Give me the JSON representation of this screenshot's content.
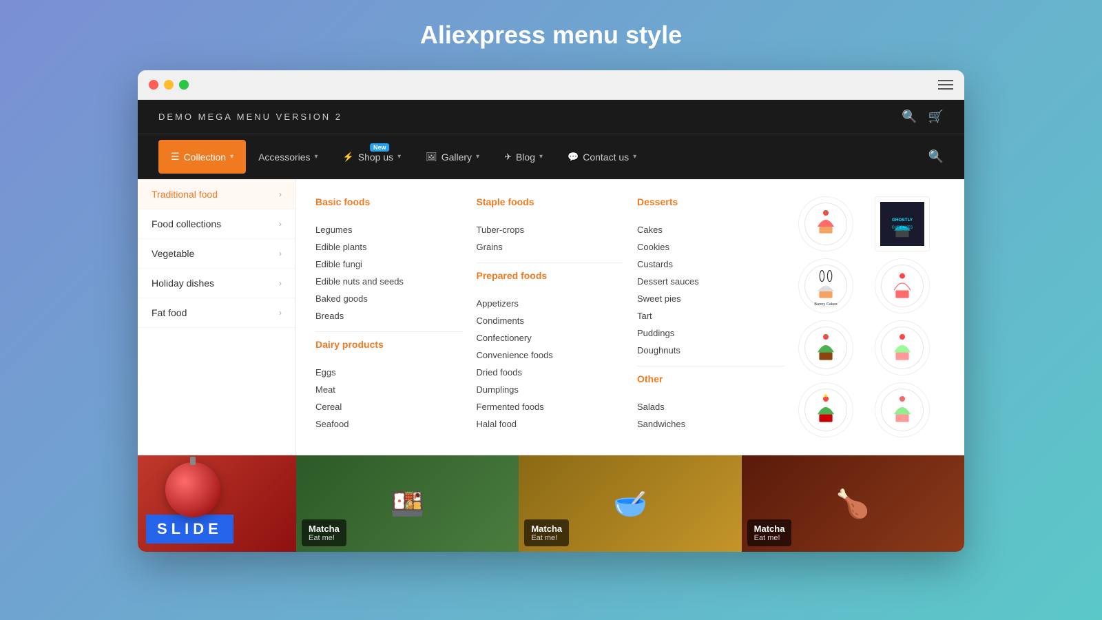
{
  "page": {
    "title": "Aliexpress menu style"
  },
  "browser": {
    "dots": [
      "red",
      "yellow",
      "green"
    ]
  },
  "navbar_top": {
    "site_title": "DEMO MEGA MENU VERSION 2"
  },
  "main_nav": {
    "items": [
      {
        "label": "Collection",
        "active": true,
        "icon": "menu-lines",
        "chevron": true
      },
      {
        "label": "Accessories",
        "active": false,
        "chevron": true
      },
      {
        "label": "Shop us",
        "active": false,
        "chevron": true,
        "badge": "New"
      },
      {
        "label": "Gallery",
        "active": false,
        "chevron": true
      },
      {
        "label": "Blog",
        "active": false,
        "chevron": true
      },
      {
        "label": "Contact us",
        "active": false,
        "chevron": true
      }
    ]
  },
  "sidebar": {
    "items": [
      {
        "label": "Traditional food",
        "active": true
      },
      {
        "label": "Food collections",
        "active": false
      },
      {
        "label": "Vegetable",
        "active": false
      },
      {
        "label": "Holiday dishes",
        "active": false
      },
      {
        "label": "Fat food",
        "active": false
      }
    ]
  },
  "menu_columns": {
    "col1": {
      "title": "Basic foods",
      "items": [
        "Legumes",
        "Edible plants",
        "Edible fungi",
        "Edible nuts and seeds",
        "Baked goods",
        "Breads"
      ]
    },
    "col1b": {
      "title": "Dairy products",
      "items": [
        "Eggs",
        "Meat",
        "Cereal",
        "Seafood"
      ]
    },
    "col2": {
      "title": "Staple foods",
      "items": [
        "Tuber-crops",
        "Grains"
      ]
    },
    "col2b": {
      "title": "Prepared foods",
      "items": [
        "Appetizers",
        "Condiments",
        "Confectionery",
        "Convenience foods",
        "Dried foods",
        "Dumplings",
        "Fermented foods",
        "Halal food"
      ]
    },
    "col3": {
      "title": "Desserts",
      "items": [
        "Cakes",
        "Cookies",
        "Custards",
        "Dessert sauces",
        "Sweet pies",
        "Tart",
        "Puddings",
        "Doughnuts"
      ]
    },
    "col3b": {
      "title": "Other",
      "items": [
        "Salads",
        "Sandwiches"
      ]
    }
  },
  "food_cards": [
    {
      "title": "Matcha",
      "subtitle": "Eat me!",
      "emoji": "🍱",
      "color": "matcha"
    },
    {
      "title": "Matcha",
      "subtitle": "Eat me!",
      "emoji": "🥣",
      "color": "grain"
    },
    {
      "title": "Matcha",
      "subtitle": "Eat me!",
      "emoji": "🍗",
      "color": "roast"
    }
  ],
  "slide_label": "SLIDE"
}
